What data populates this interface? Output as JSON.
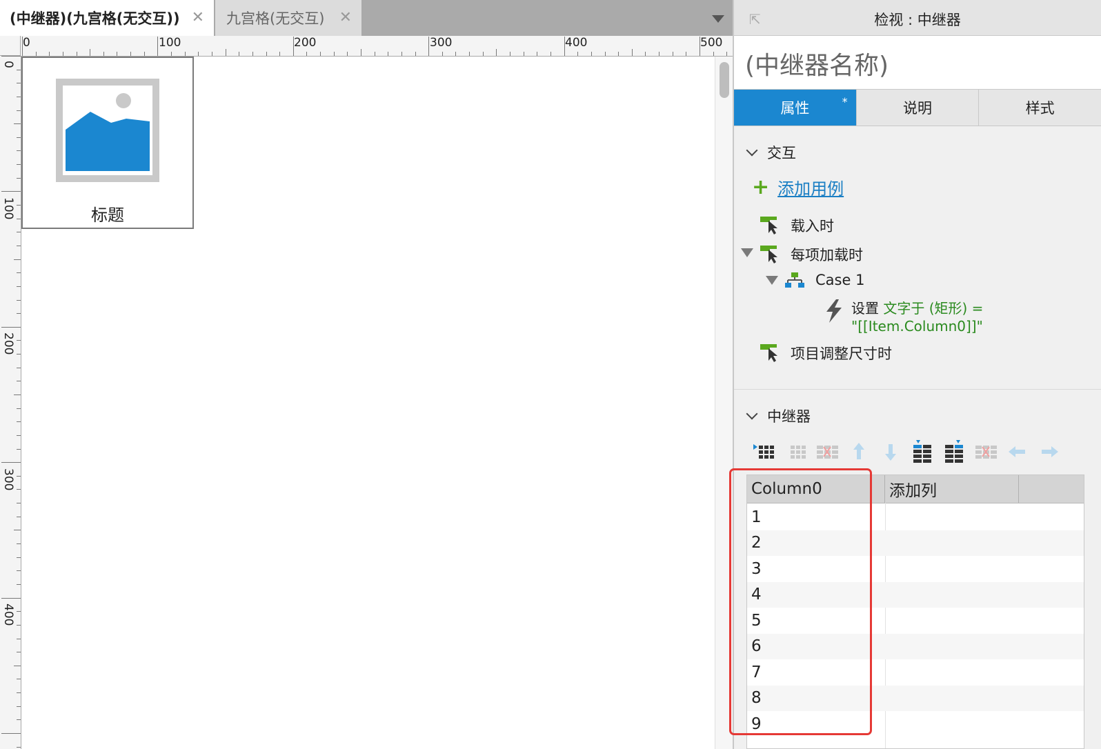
{
  "tabs": [
    {
      "label": "(中继器)(九宫格(无交互))",
      "close": "✕"
    },
    {
      "label": "九宫格(无交互)",
      "close": "✕"
    }
  ],
  "ruler": {
    "top_labels": [
      "0",
      "100",
      "200",
      "300",
      "400",
      "500"
    ],
    "left_labels": [
      "0",
      "100",
      "200",
      "300",
      "400"
    ]
  },
  "canvas": {
    "widget_title": "标题"
  },
  "inspector": {
    "title": "检视 : 中继器",
    "name_placeholder": "(中继器名称)",
    "tabs": [
      "属性",
      "说明",
      "样式"
    ],
    "active_tab_marker": "*",
    "interaction_section": "交互",
    "add_case": "添加用例",
    "events": [
      {
        "label": "载入时"
      },
      {
        "label": "每项加载时"
      },
      {
        "label": "Case 1"
      },
      {
        "label": "项目调整尺寸时"
      }
    ],
    "action": {
      "verb": "设置",
      "target": "文字于 (矩形) =",
      "value": "\"[[Item.Column0]]\""
    },
    "repeater_section": "中继器",
    "toolbar_icons": [
      "insert-row-icon",
      "insert-row-disabled-icon",
      "delete-row-disabled-icon",
      "move-up-icon",
      "move-down-icon",
      "insert-col-before-icon",
      "insert-col-after-icon",
      "delete-col-disabled-icon",
      "move-left-icon",
      "move-right-icon"
    ],
    "grid": {
      "columns": [
        "Column0",
        "添加列"
      ],
      "rows": [
        "1",
        "2",
        "3",
        "4",
        "5",
        "6",
        "7",
        "8",
        "9"
      ]
    }
  },
  "colors": {
    "accent": "#1b87d0",
    "link": "#1b7fc4",
    "green": "#5aa81e",
    "highlight": "#e53935"
  }
}
